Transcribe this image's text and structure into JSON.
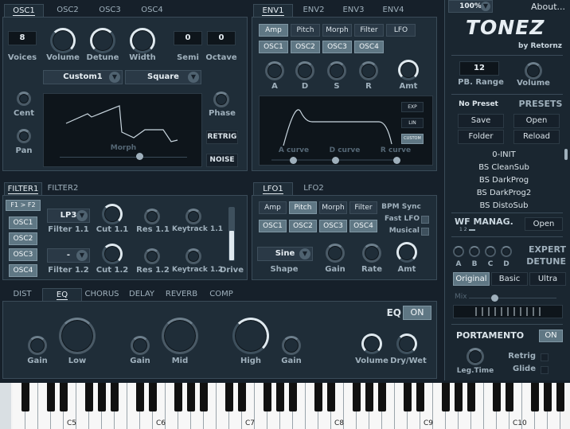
{
  "osc": {
    "tabs": [
      "OSC1",
      "OSC2",
      "OSC3",
      "OSC4"
    ],
    "voices": "8",
    "semi": "0",
    "octave": "0",
    "labels": {
      "voices": "Voices",
      "volume": "Volume",
      "detune": "Detune",
      "width": "Width",
      "semi": "Semi",
      "octave": "Octave",
      "cent": "Cent",
      "pan": "Pan",
      "phase": "Phase",
      "morph": "Morph"
    },
    "wave1": "Custom1",
    "wave2": "Square",
    "retrig": "RETRIG",
    "noise": "NOISE"
  },
  "env": {
    "tabs": [
      "ENV1",
      "ENV2",
      "ENV3",
      "ENV4"
    ],
    "targets": [
      "Amp",
      "Pitch",
      "Morph",
      "Filter",
      "LFO"
    ],
    "oscs": [
      "OSC1",
      "OSC2",
      "OSC3",
      "OSC4"
    ],
    "knobs": [
      "A",
      "D",
      "S",
      "R",
      "Amt"
    ],
    "curve_modes": [
      "EXP",
      "LIN",
      "CUSTOM"
    ],
    "curves": [
      "A curve",
      "D curve",
      "R curve"
    ]
  },
  "filter": {
    "tabs": [
      "FILTER1",
      "FILTER2"
    ],
    "routing": "F1 > F2",
    "oscs": [
      "OSC1",
      "OSC2",
      "OSC3",
      "OSC4"
    ],
    "type1": "LP3",
    "type2": "-",
    "labels": {
      "f11": "Filter 1.1",
      "cut11": "Cut 1.1",
      "res11": "Res 1.1",
      "key11": "Keytrack 1.1",
      "f12": "Filter 1.2",
      "cut12": "Cut 1.2",
      "res12": "Res 1.2",
      "key12": "Keytrack 1.2",
      "drive": "Drive"
    }
  },
  "lfo": {
    "tabs": [
      "LFO1",
      "LFO2"
    ],
    "targets": [
      "Amp",
      "Pitch",
      "Morph",
      "Filter"
    ],
    "oscs": [
      "OSC1",
      "OSC2",
      "OSC3",
      "OSC4"
    ],
    "bpm": "BPM Sync",
    "fast": "Fast LFO",
    "musical": "Musical",
    "shape": "Sine",
    "labels": {
      "shape": "Shape",
      "gain": "Gain",
      "rate": "Rate",
      "amt": "Amt"
    }
  },
  "fx": {
    "tabs": [
      "DIST",
      "EQ",
      "CHORUS",
      "DELAY",
      "REVERB",
      "COMP"
    ],
    "title": "EQ",
    "on": "ON",
    "labels": [
      "Gain",
      "Low",
      "Gain",
      "Mid",
      "High",
      "Gain",
      "Volume",
      "Dry/Wet"
    ]
  },
  "right": {
    "zoom": "100%",
    "about": "About...",
    "logo": "TONEZ",
    "by": "by Retornz",
    "pb_range": "12",
    "pb_label": "PB. Range",
    "vol_label": "Volume",
    "no_preset": "No Preset",
    "presets": "PRESETS",
    "save": "Save",
    "open": "Open",
    "folder": "Folder",
    "reload": "Reload",
    "list": [
      "0-INIT",
      "BS CleanSub",
      "BS DarkProg",
      "BS DarkProg2",
      "BS DistoSub"
    ],
    "wf": "WF MANAG.",
    "wf_open": "Open",
    "wf_nums": "1  2",
    "expert": "EXPERT",
    "detune": "DETUNE",
    "abcd": [
      "A",
      "B",
      "C",
      "D"
    ],
    "modes": [
      "Original",
      "Basic",
      "Ultra"
    ],
    "mix": "Mix",
    "porta": "PORTAMENTO",
    "porta_on": "ON",
    "leg": "Leg.Time",
    "retrig": "Retrig",
    "glide": "Glide"
  },
  "keys": [
    "C5",
    "C6",
    "C7",
    "C8",
    "C9",
    "C10"
  ],
  "colors": {
    "bg": "#16202a",
    "panel": "#1f2d38",
    "accent": "#5f7784",
    "knob_on": "#dfe9ef"
  }
}
